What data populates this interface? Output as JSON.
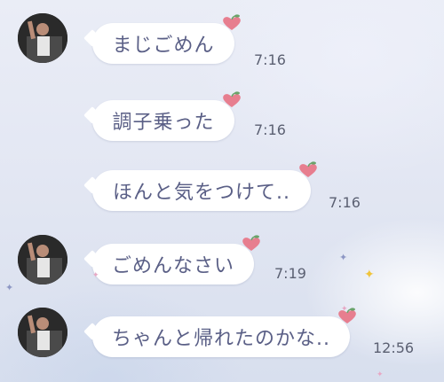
{
  "messages": [
    {
      "text": "まじごめん",
      "time": "7:16",
      "has_avatar": true
    },
    {
      "text": "調子乗った",
      "time": "7:16",
      "has_avatar": false
    },
    {
      "text": "ほんと気をつけて..",
      "time": "7:16",
      "has_avatar": false
    },
    {
      "text": "ごめんなさい",
      "time": "7:19",
      "has_avatar": true
    },
    {
      "text": "ちゃんと帰れたのかな..",
      "time": "12:56",
      "has_avatar": true
    }
  ],
  "colors": {
    "bubble": "#ffffff",
    "bubble_text": "#5a5f86",
    "time_text": "#5b6072",
    "heart_accent": "#e77e8f",
    "leaf_accent": "#6aa36a"
  },
  "icons": {
    "avatar": "profile-photo",
    "bubble_decoration": "heart-icon",
    "sparkle": "sparkle-icon"
  }
}
